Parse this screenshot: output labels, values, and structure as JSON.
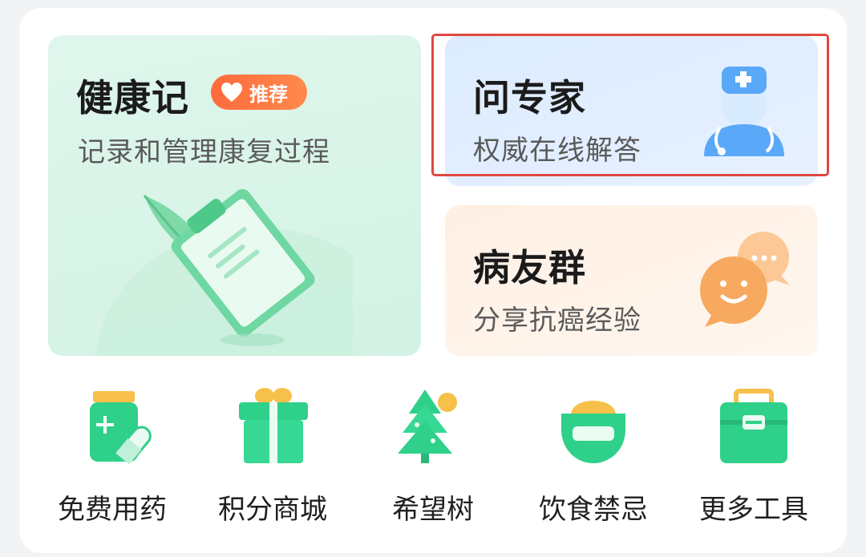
{
  "cards": {
    "health": {
      "title": "健康记",
      "badge": "推荐",
      "subtitle": "记录和管理康复过程"
    },
    "expert": {
      "title": "问专家",
      "subtitle": "权威在线解答"
    },
    "group": {
      "title": "病友群",
      "subtitle": "分享抗癌经验"
    }
  },
  "tools": [
    {
      "label": "免费用药",
      "icon": "medicine-bottle-icon"
    },
    {
      "label": "积分商城",
      "icon": "gift-box-icon"
    },
    {
      "label": "希望树",
      "icon": "tree-icon"
    },
    {
      "label": "饮食禁忌",
      "icon": "food-bowl-icon"
    },
    {
      "label": "更多工具",
      "icon": "toolbox-icon"
    }
  ],
  "colors": {
    "accent_green": "#2fd089",
    "badge_orange": "#ff6f3f",
    "highlight_red": "#e0483f",
    "expert_blue": "#4a9cf5",
    "group_orange": "#f7a45e"
  }
}
